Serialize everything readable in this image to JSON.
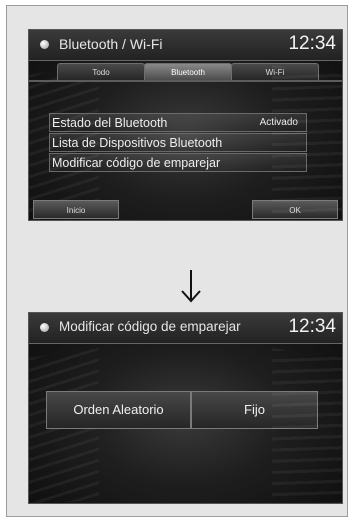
{
  "screen1": {
    "title": "Bluetooth / Wi-Fi",
    "clock": "12:34",
    "tabs": [
      {
        "label": "Todo",
        "active": false
      },
      {
        "label": "Bluetooth",
        "active": true
      },
      {
        "label": "Wi-Fi",
        "active": false
      }
    ],
    "menu": [
      {
        "label": "Estado del Bluetooth",
        "value": "Activado"
      },
      {
        "label": "Lista de Dispositivos Bluetooth",
        "value": ""
      },
      {
        "label": "Modificar código de emparejar",
        "value": ""
      }
    ],
    "bottom_left": "Inicio",
    "bottom_right": "OK"
  },
  "arrow_icon": "down-arrow",
  "screen2": {
    "title": "Modificar código de emparejar",
    "clock": "12:34",
    "options": [
      "Orden Aleatorio",
      "Fijo"
    ]
  }
}
